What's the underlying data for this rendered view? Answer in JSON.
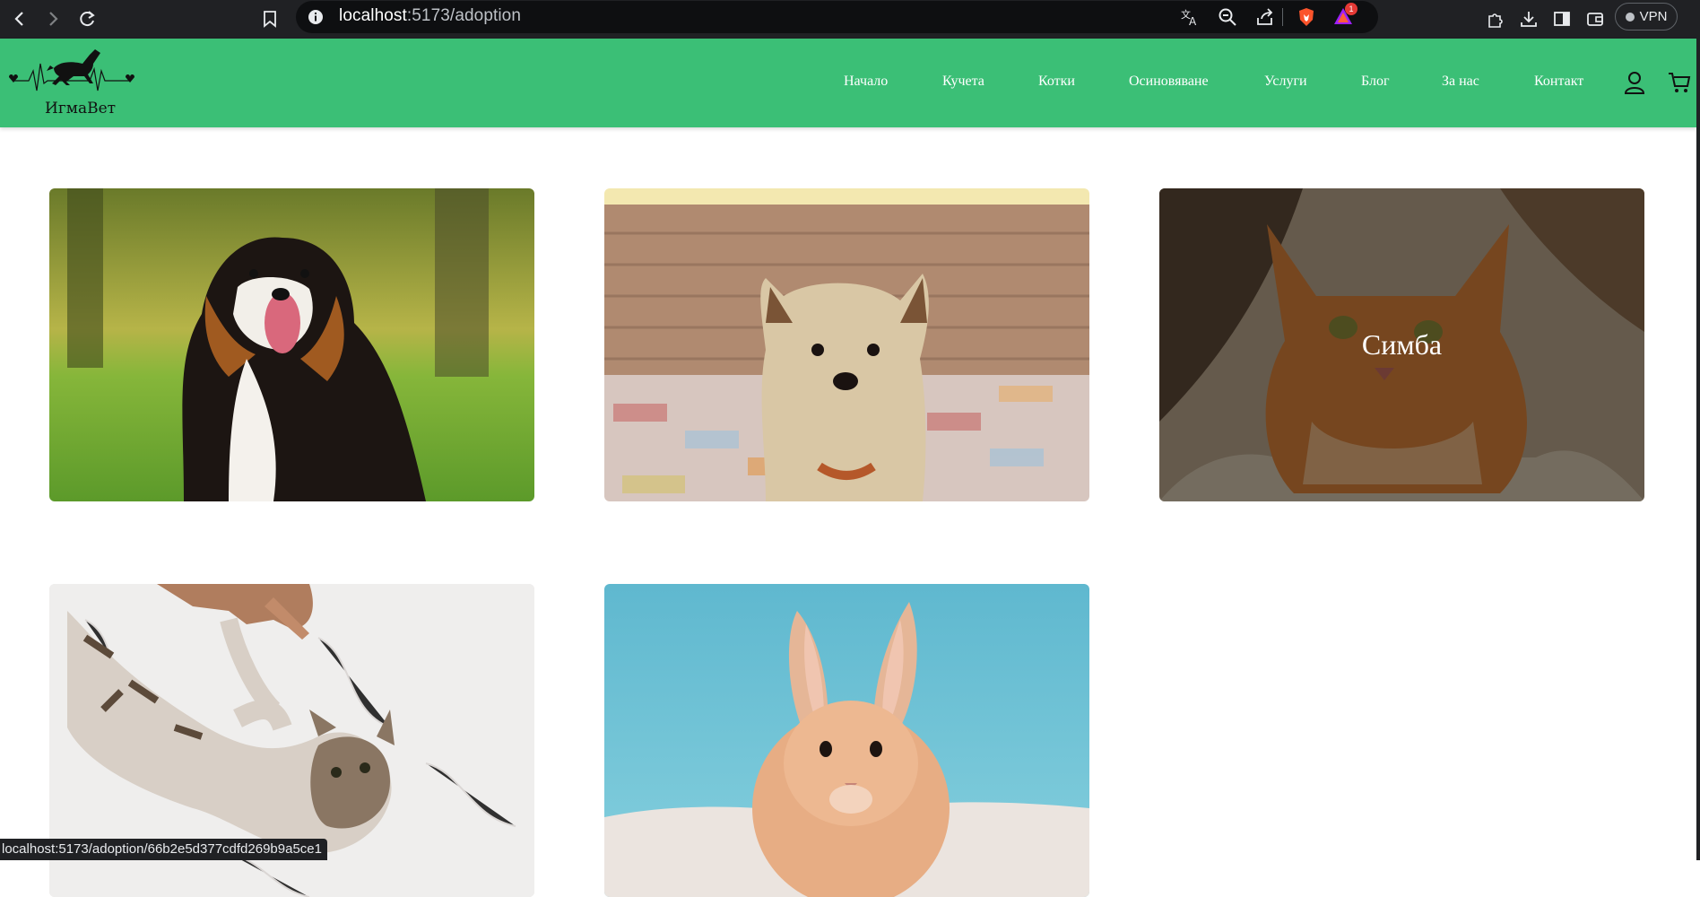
{
  "browser": {
    "url_host": "localhost",
    "url_path": ":5173/adoption",
    "rewards_badge": "1",
    "vpn_label": "VPN",
    "status_url": "localhost:5173/adoption/66b2e5d377cdfd269b9a5ce1"
  },
  "site": {
    "brand": "ИгмаВет",
    "nav": [
      {
        "label": "Начало"
      },
      {
        "label": "Кучета"
      },
      {
        "label": "Котки"
      },
      {
        "label": "Осиновяване"
      },
      {
        "label": "Услуги"
      },
      {
        "label": "Блог"
      },
      {
        "label": "За нас"
      },
      {
        "label": "Контакт"
      }
    ],
    "colors": {
      "header": "#3bbf76",
      "text_on_header": "#ffffff"
    }
  },
  "cards": [
    {
      "animal": "dog",
      "caption": ""
    },
    {
      "animal": "dog",
      "caption": ""
    },
    {
      "animal": "cat",
      "caption": "Симба"
    },
    {
      "animal": "cat",
      "caption": ""
    },
    {
      "animal": "rabbit",
      "caption": ""
    }
  ]
}
